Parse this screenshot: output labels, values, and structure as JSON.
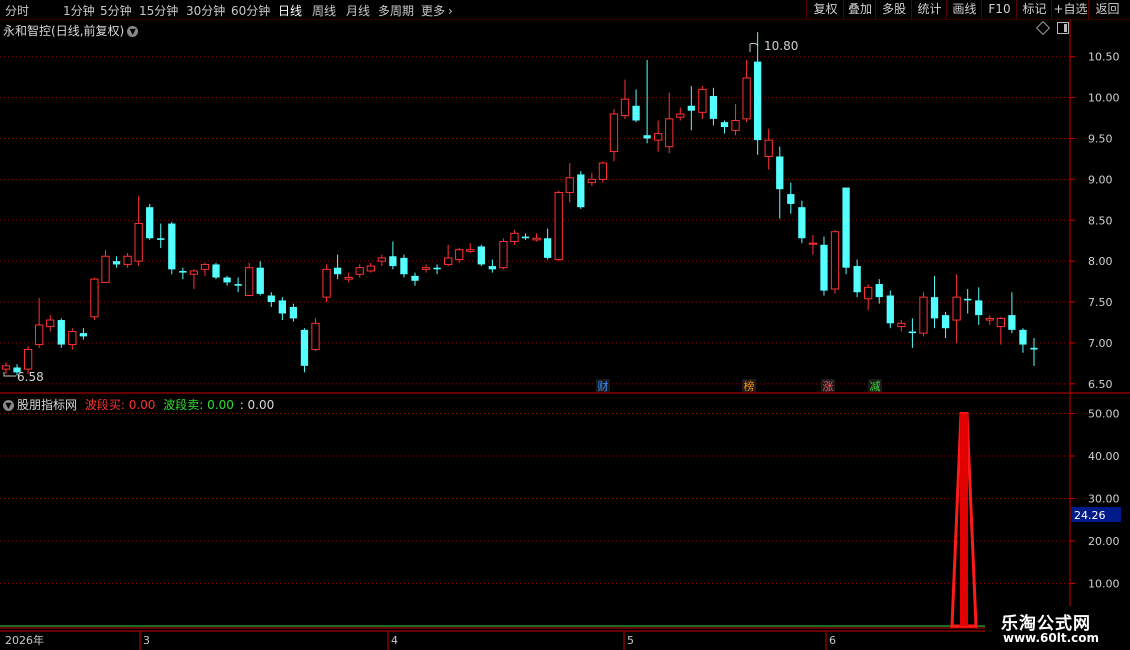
{
  "toolbar": {
    "periods": [
      "分时",
      "1分钟",
      "5分钟",
      "15分钟",
      "30分钟",
      "60分钟",
      "日线",
      "周线",
      "月线",
      "多周期",
      "更多"
    ],
    "active_period": "日线",
    "right_buttons": [
      "复权",
      "叠加",
      "多股",
      "统计",
      "画线",
      "F10",
      "标记",
      "+自选",
      "返回"
    ]
  },
  "title": {
    "stock_name": "永和智控",
    "mode": "(日线,前复权)"
  },
  "colors": {
    "up": "#ff3232",
    "down": "#54ffff",
    "grid": "#8b0000",
    "axis": "#cc0000",
    "bg": "#000000"
  },
  "main_chart": {
    "y_ticks": [
      "10.50",
      "10.00",
      "9.50",
      "9.00",
      "8.50",
      "8.00",
      "7.50",
      "7.00",
      "6.50"
    ],
    "high_label": "10.80",
    "low_label": "6.58",
    "events": [
      {
        "text": "财",
        "color": "#3a8cff"
      },
      {
        "text": "榜",
        "color": "#ff8c00"
      },
      {
        "text": "涨",
        "color": "#ff5050"
      },
      {
        "text": "减",
        "color": "#33dd33"
      }
    ]
  },
  "indicator": {
    "name": "股朋指标网",
    "buy_label": "波段买:",
    "buy_value": "0.00",
    "sell_label": "波段卖:",
    "sell_value": "0.00",
    "third_value": ": 0.00",
    "y_ticks": [
      "50.00",
      "40.00",
      "30.00",
      "20.00",
      "10.00"
    ],
    "cursor_value": "24.26"
  },
  "date_axis": {
    "year": "2026年",
    "months": [
      "3",
      "4",
      "5",
      "6"
    ]
  },
  "watermark": {
    "cn": "乐淘公式网",
    "url": "www.60lt.com"
  },
  "chart_data": {
    "type": "candlestick",
    "y_range": [
      6.4,
      10.9
    ],
    "candles": [
      [
        6.68,
        6.72,
        6.62,
        6.76
      ],
      [
        6.7,
        6.64,
        6.6,
        6.74
      ],
      [
        6.68,
        6.92,
        6.62,
        6.96
      ],
      [
        6.98,
        7.22,
        6.94,
        7.55
      ],
      [
        7.2,
        7.28,
        7.14,
        7.34
      ],
      [
        7.28,
        6.98,
        6.94,
        7.3
      ],
      [
        6.98,
        7.14,
        6.92,
        7.18
      ],
      [
        7.12,
        7.08,
        7.04,
        7.18
      ],
      [
        7.32,
        7.78,
        7.28,
        7.8
      ],
      [
        7.74,
        8.06,
        7.74,
        8.14
      ],
      [
        8.0,
        7.96,
        7.92,
        8.06
      ],
      [
        7.96,
        8.06,
        7.92,
        8.1
      ],
      [
        8.0,
        8.46,
        7.94,
        8.8
      ],
      [
        8.66,
        8.28,
        8.26,
        8.7
      ],
      [
        8.28,
        8.26,
        8.16,
        8.46
      ],
      [
        8.46,
        7.9,
        7.84,
        8.48
      ],
      [
        7.88,
        7.86,
        7.78,
        7.92
      ],
      [
        7.84,
        7.88,
        7.66,
        7.9
      ],
      [
        7.9,
        7.96,
        7.82,
        7.98
      ],
      [
        7.96,
        7.8,
        7.78,
        7.98
      ],
      [
        7.8,
        7.74,
        7.7,
        7.82
      ],
      [
        7.72,
        7.7,
        7.62,
        7.8
      ],
      [
        7.58,
        7.92,
        7.58,
        7.98
      ],
      [
        7.92,
        7.6,
        7.58,
        8.0
      ],
      [
        7.58,
        7.5,
        7.44,
        7.62
      ],
      [
        7.52,
        7.36,
        7.28,
        7.56
      ],
      [
        7.44,
        7.3,
        7.26,
        7.48
      ],
      [
        7.16,
        6.72,
        6.64,
        7.18
      ],
      [
        6.92,
        7.24,
        6.9,
        7.3
      ],
      [
        7.56,
        7.9,
        7.5,
        7.96
      ],
      [
        7.92,
        7.84,
        7.78,
        8.08
      ],
      [
        7.78,
        7.8,
        7.74,
        7.86
      ],
      [
        7.84,
        7.92,
        7.8,
        7.96
      ],
      [
        7.88,
        7.94,
        7.86,
        7.98
      ],
      [
        8.0,
        8.04,
        7.94,
        8.08
      ],
      [
        8.06,
        7.94,
        7.9,
        8.24
      ],
      [
        8.04,
        7.84,
        7.8,
        8.08
      ],
      [
        7.82,
        7.76,
        7.7,
        7.86
      ],
      [
        7.9,
        7.92,
        7.86,
        7.96
      ],
      [
        7.92,
        7.9,
        7.84,
        7.96
      ],
      [
        7.96,
        8.04,
        7.94,
        8.2
      ],
      [
        8.02,
        8.14,
        7.98,
        8.16
      ],
      [
        8.12,
        8.14,
        8.1,
        8.22
      ],
      [
        8.18,
        7.96,
        7.94,
        8.2
      ],
      [
        7.94,
        7.9,
        7.86,
        8.02
      ],
      [
        7.92,
        8.24,
        7.9,
        8.28
      ],
      [
        8.24,
        8.34,
        8.2,
        8.38
      ],
      [
        8.3,
        8.28,
        8.26,
        8.34
      ],
      [
        8.26,
        8.28,
        8.24,
        8.34
      ],
      [
        8.28,
        8.04,
        8.02,
        8.4
      ],
      [
        8.02,
        8.84,
        8.0,
        8.86
      ],
      [
        8.84,
        9.02,
        8.72,
        9.2
      ],
      [
        9.06,
        8.66,
        8.64,
        9.1
      ],
      [
        8.96,
        9.0,
        8.92,
        9.08
      ],
      [
        9.0,
        9.2,
        8.96,
        9.22
      ],
      [
        9.34,
        9.8,
        9.22,
        9.86
      ],
      [
        9.78,
        9.98,
        9.74,
        10.22
      ],
      [
        9.9,
        9.72,
        9.7,
        10.1
      ],
      [
        9.54,
        9.5,
        9.44,
        10.46
      ],
      [
        9.48,
        9.56,
        9.34,
        9.72
      ],
      [
        9.4,
        9.74,
        9.32,
        10.06
      ],
      [
        9.76,
        9.8,
        9.72,
        9.88
      ],
      [
        9.9,
        9.84,
        9.6,
        10.14
      ],
      [
        9.82,
        10.1,
        9.74,
        10.14
      ],
      [
        10.02,
        9.74,
        9.66,
        10.12
      ],
      [
        9.7,
        9.64,
        9.56,
        9.72
      ],
      [
        9.6,
        9.72,
        9.54,
        9.92
      ],
      [
        9.74,
        10.24,
        9.7,
        10.46
      ],
      [
        10.44,
        9.48,
        9.3,
        10.8
      ],
      [
        9.28,
        9.48,
        9.12,
        9.62
      ],
      [
        9.28,
        8.88,
        8.52,
        9.4
      ],
      [
        8.82,
        8.7,
        8.58,
        8.96
      ],
      [
        8.66,
        8.28,
        8.22,
        8.74
      ],
      [
        8.22,
        8.22,
        8.08,
        8.32
      ],
      [
        8.2,
        7.64,
        7.58,
        8.3
      ],
      [
        7.66,
        8.36,
        7.6,
        8.38
      ],
      [
        8.9,
        7.92,
        7.84,
        8.9
      ],
      [
        7.94,
        7.62,
        7.56,
        8.02
      ],
      [
        7.54,
        7.68,
        7.4,
        7.72
      ],
      [
        7.72,
        7.56,
        7.48,
        7.78
      ],
      [
        7.58,
        7.24,
        7.18,
        7.64
      ],
      [
        7.2,
        7.24,
        7.14,
        7.28
      ],
      [
        7.14,
        7.12,
        6.94,
        7.3
      ],
      [
        7.12,
        7.56,
        7.08,
        7.62
      ],
      [
        7.56,
        7.3,
        7.18,
        7.82
      ],
      [
        7.34,
        7.18,
        7.06,
        7.38
      ],
      [
        7.28,
        7.56,
        7.0,
        7.84
      ],
      [
        7.54,
        7.52,
        7.36,
        7.66
      ],
      [
        7.52,
        7.34,
        7.22,
        7.68
      ],
      [
        7.28,
        7.3,
        7.22,
        7.34
      ],
      [
        7.2,
        7.3,
        6.98,
        7.32
      ],
      [
        7.34,
        7.16,
        7.12,
        7.62
      ],
      [
        7.16,
        6.98,
        6.88,
        7.18
      ],
      [
        6.94,
        6.92,
        6.72,
        7.06
      ]
    ],
    "indicator": {
      "type": "spike",
      "y_range": [
        0,
        52
      ],
      "peak": 50.0,
      "baseline": 0
    }
  }
}
